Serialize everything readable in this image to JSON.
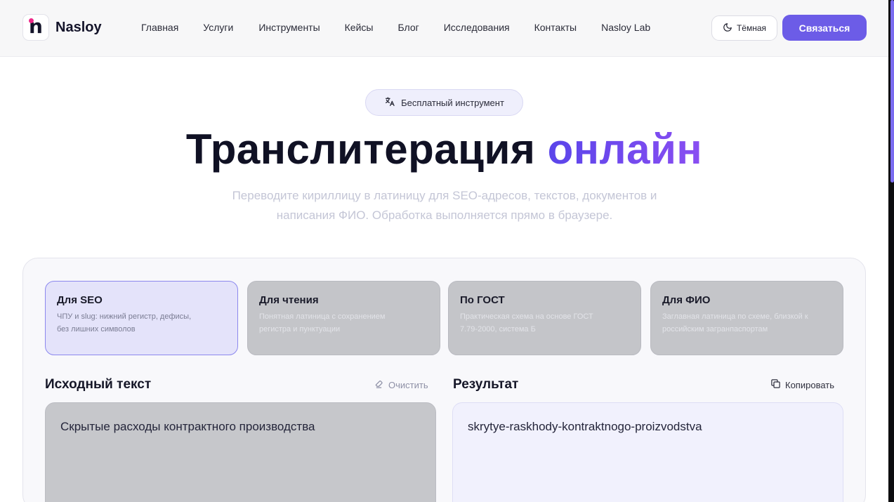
{
  "header": {
    "logo_text": "Nasloy",
    "logo_mark": "n",
    "nav": [
      "Главная",
      "Услуги",
      "Инструменты",
      "Кейсы",
      "Блог",
      "Исследования",
      "Контакты",
      "Nasloy Lab"
    ],
    "theme_label": "Тёмная",
    "contact_label": "Связаться"
  },
  "hero": {
    "badge": "Бесплатный инструмент",
    "title_main": "Транслитерация",
    "title_accent": "онлайн",
    "subtitle_line1": "Переводите кириллицу в латиницу для SEO-адресов, текстов, документов и",
    "subtitle_line2": "написания ФИО. Обработка выполняется прямо в браузере."
  },
  "modes": [
    {
      "title": "Для SEO",
      "desc_line1": "ЧПУ и slug: нижний регистр, дефисы,",
      "desc_line2": "без лишних символов"
    },
    {
      "title": "Для чтения",
      "desc_line1": "Понятная латиница с сохранением",
      "desc_line2": "регистра и пунктуации"
    },
    {
      "title": "По ГОСТ",
      "desc_line1": "Практическая схема на основе ГОСТ",
      "desc_line2": "7.79-2000, система Б"
    },
    {
      "title": "Для ФИО",
      "desc_line1": "Заглавная латиница по схеме, близкой к",
      "desc_line2": "российским загранпаспортам"
    }
  ],
  "source": {
    "label": "Исходный текст",
    "clear_label": "Очистить",
    "value": "Скрытые расходы контрактного производства"
  },
  "result": {
    "label": "Результат",
    "copy_label": "Копировать",
    "value": "skrytye-raskhody-kontraktnogo-proizvodstva"
  },
  "colors": {
    "accent": "#6c5ce7",
    "logo_dot": "#ee2a8a",
    "active_mode_bg": "#e4e3fa",
    "inactive_mode_bg": "#c4c5c9"
  },
  "icons": {
    "theme": "moon-icon",
    "badge": "translate-icon",
    "clear": "eraser-icon",
    "copy": "copy-icon"
  }
}
